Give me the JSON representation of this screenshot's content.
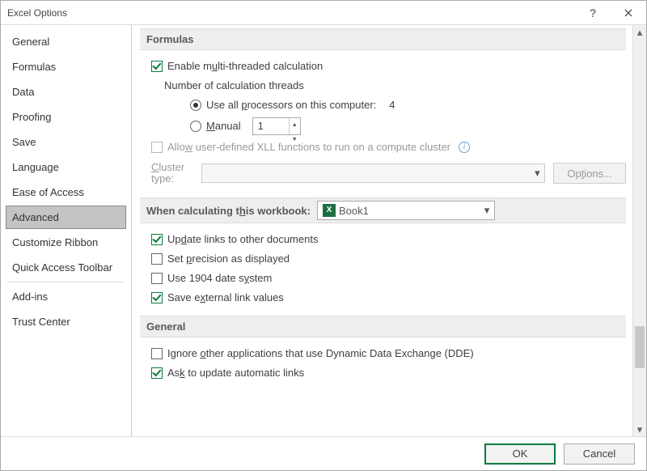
{
  "window": {
    "title": "Excel Options"
  },
  "sidebar": {
    "items": [
      {
        "label": "General",
        "selected": false
      },
      {
        "label": "Formulas",
        "selected": false
      },
      {
        "label": "Data",
        "selected": false
      },
      {
        "label": "Proofing",
        "selected": false
      },
      {
        "label": "Save",
        "selected": false
      },
      {
        "label": "Language",
        "selected": false
      },
      {
        "label": "Ease of Access",
        "selected": false
      },
      {
        "label": "Advanced",
        "selected": true
      },
      {
        "label": "Customize Ribbon",
        "selected": false
      },
      {
        "label": "Quick Access Toolbar",
        "selected": false
      },
      {
        "label": "Add-ins",
        "selected": false
      },
      {
        "label": "Trust Center",
        "selected": false
      }
    ]
  },
  "sections": {
    "formulas": {
      "heading": "Formulas",
      "enable_mt_pre": "Enable m",
      "enable_mt_u": "u",
      "enable_mt_post": "lti-threaded calculation",
      "enable_mt_checked": true,
      "threads_label": "Number of calculation threads",
      "use_all_pre": "Use all ",
      "use_all_u": "p",
      "use_all_post": "rocessors on this computer:",
      "processor_count": "4",
      "use_all_selected": true,
      "manual_u": "M",
      "manual_post": "anual",
      "manual_value": "1",
      "allow_xll_pre": "Allo",
      "allow_xll_u": "w",
      "allow_xll_post": " user-defined XLL functions to run on a compute cluster",
      "allow_xll_checked": false,
      "cluster_type_u": "C",
      "cluster_type_post": "luster type:",
      "cluster_value": "",
      "options_btn_pre": "Op",
      "options_btn_u": "t",
      "options_btn_post": "ions..."
    },
    "workbook": {
      "heading_pre": "When calculating t",
      "heading_u": "h",
      "heading_post": "is workbook:",
      "workbook_name": "Book1",
      "update_links_pre": "Up",
      "update_links_u": "d",
      "update_links_post": "ate links to other documents",
      "update_links_checked": true,
      "precision_pre": "Set ",
      "precision_u": "p",
      "precision_post": "recision as displayed",
      "precision_checked": false,
      "date1904_pre": "Use 1904 date s",
      "date1904_u": "y",
      "date1904_post": "stem",
      "date1904_checked": false,
      "save_ext_pre": "Save e",
      "save_ext_u": "x",
      "save_ext_post": "ternal link values",
      "save_ext_checked": true
    },
    "general": {
      "heading": "General",
      "ignore_dde_pre": "Ignore ",
      "ignore_dde_u": "o",
      "ignore_dde_post": "ther applications that use Dynamic Data Exchange (DDE)",
      "ignore_dde_checked": false,
      "ask_update_pre": "As",
      "ask_update_u": "k",
      "ask_update_post": " to update automatic links",
      "ask_update_checked": true
    }
  },
  "footer": {
    "ok": "OK",
    "cancel": "Cancel"
  }
}
